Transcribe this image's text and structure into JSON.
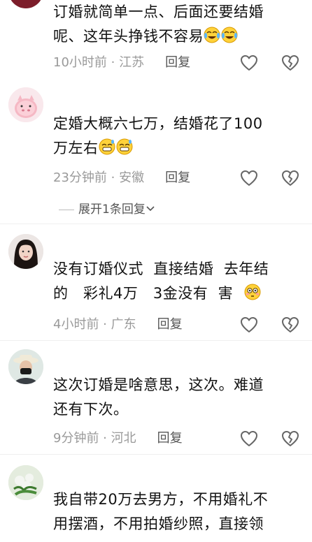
{
  "comments": [
    {
      "username": "",
      "lines": [
        "订婚就简单一点、后面还要结婚",
        "呢、这年头挣钱不容易"
      ],
      "emoji": "laughing-crying",
      "time": "10小时前",
      "location": "江苏",
      "reply": "回复"
    },
    {
      "username": "",
      "lines": [
        "定婚大概六七万，结婚花了100",
        "万左右"
      ],
      "emoji": "grin-sweat",
      "time": "23分钟前",
      "location": "安徽",
      "reply": "回复",
      "expand": "展开1条回复"
    },
    {
      "username": "",
      "lines": [
        "没有订婚仪式  直接结婚  去年结",
        "的   彩礼4万   3金没有  害"
      ],
      "emoji": "flushed",
      "time": "4小时前",
      "location": "广东",
      "reply": "回复"
    },
    {
      "username": "",
      "lines": [
        "这次订婚是啥意思，这次。难道",
        "还有下次。"
      ],
      "time": "9分钟前",
      "location": "河北",
      "reply": "回复"
    },
    {
      "username": "",
      "lines": [
        "我自带20万去男方，不用婚礼不",
        "用摆酒，不用拍婚纱照，直接领"
      ],
      "time": "",
      "location": "",
      "reply": ""
    }
  ],
  "separator": " · ",
  "watermark": "",
  "icons": {
    "like": "heart-outline-icon",
    "dislike": "broken-heart-outline-icon",
    "expand": "chevron-down-icon"
  },
  "colors": {
    "text": "#121212",
    "meta": "#9a9a9a",
    "reply": "#555555",
    "icon": "#666666"
  }
}
